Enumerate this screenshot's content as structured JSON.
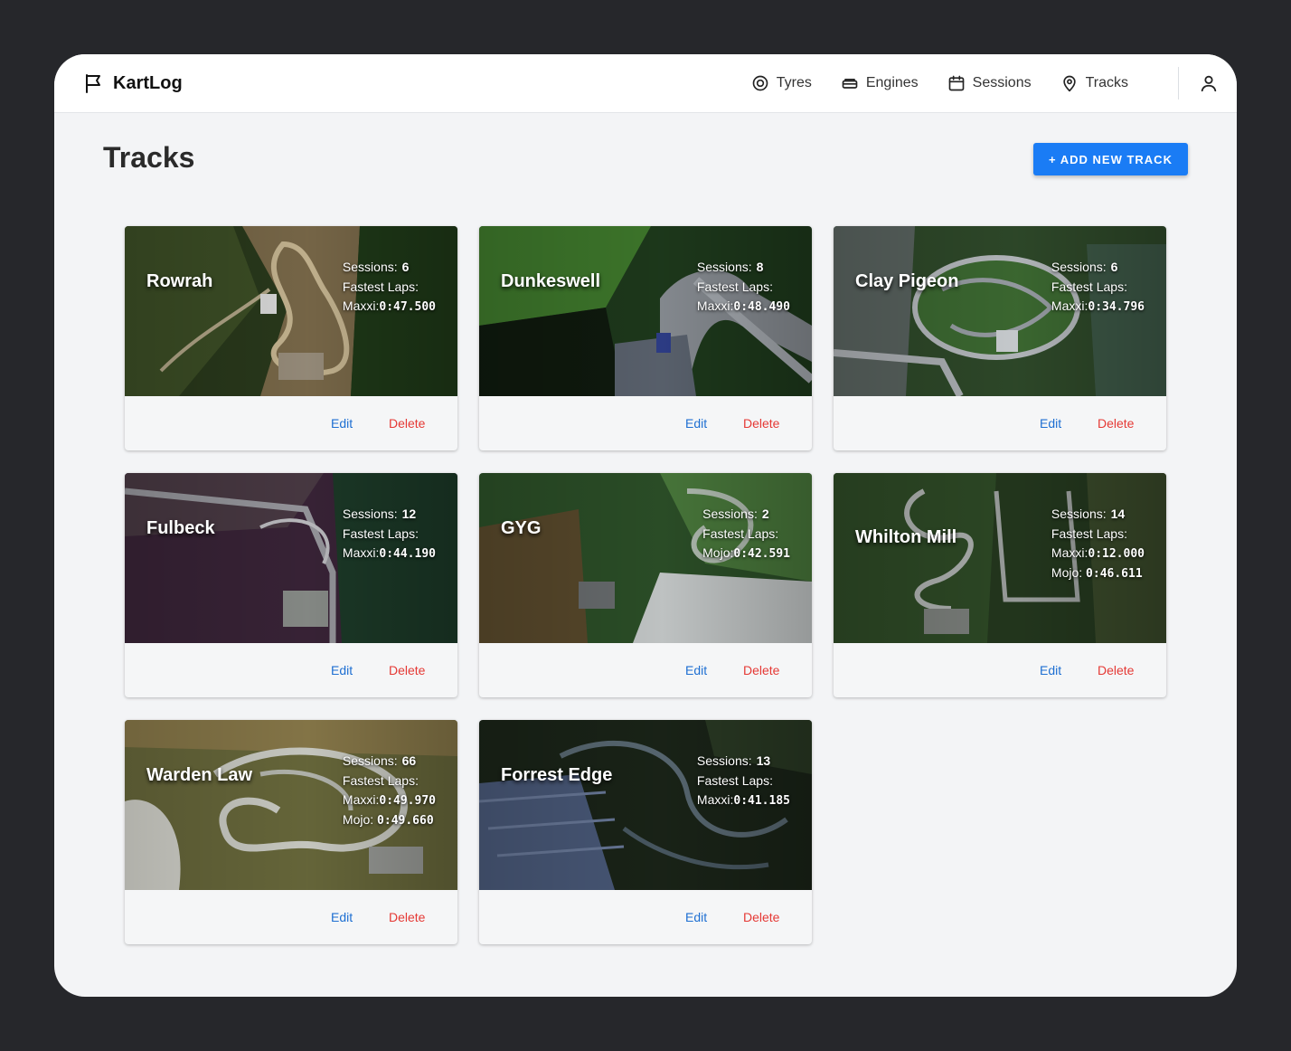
{
  "app": {
    "name": "KartLog"
  },
  "nav": [
    {
      "label": "Tyres",
      "icon": "target-icon"
    },
    {
      "label": "Engines",
      "icon": "engine-icon"
    },
    {
      "label": "Sessions",
      "icon": "calendar-icon"
    },
    {
      "label": "Tracks",
      "icon": "map-pin-icon"
    }
  ],
  "page": {
    "title": "Tracks",
    "add_button": "+ ADD NEW TRACK"
  },
  "labels": {
    "sessions": "Sessions:",
    "fastest": "Fastest Laps:",
    "edit": "Edit",
    "delete": "Delete"
  },
  "colors": {
    "accent": "#1a7cf5",
    "edit": "#1e6fd2",
    "delete": "#e53935"
  },
  "tracks": [
    {
      "name": "Rowrah",
      "sessions": "6",
      "laps": [
        {
          "tyre": "Maxxi:",
          "time": "0:47.500"
        }
      ]
    },
    {
      "name": "Dunkeswell",
      "sessions": "8",
      "laps": [
        {
          "tyre": "Maxxi:",
          "time": "0:48.490"
        }
      ]
    },
    {
      "name": "Clay Pigeon",
      "sessions": "6",
      "laps": [
        {
          "tyre": "Maxxi:",
          "time": "0:34.796"
        }
      ]
    },
    {
      "name": "Fulbeck",
      "sessions": "12",
      "laps": [
        {
          "tyre": "Maxxi:",
          "time": "0:44.190"
        }
      ]
    },
    {
      "name": "GYG",
      "sessions": "2",
      "laps": [
        {
          "tyre": "Mojo:",
          "time": "0:42.591"
        }
      ]
    },
    {
      "name": "Whilton Mill",
      "sessions": "14",
      "laps": [
        {
          "tyre": "Maxxi:",
          "time": "0:12.000"
        },
        {
          "tyre": "Mojo:",
          "time": "0:46.611"
        }
      ]
    },
    {
      "name": "Warden Law",
      "sessions": "66",
      "laps": [
        {
          "tyre": "Maxxi:",
          "time": "0:49.970"
        },
        {
          "tyre": "Mojo:",
          "time": "0:49.660"
        }
      ]
    },
    {
      "name": "Forrest Edge",
      "sessions": "13",
      "laps": [
        {
          "tyre": "Maxxi:",
          "time": "0:41.185"
        }
      ]
    }
  ]
}
